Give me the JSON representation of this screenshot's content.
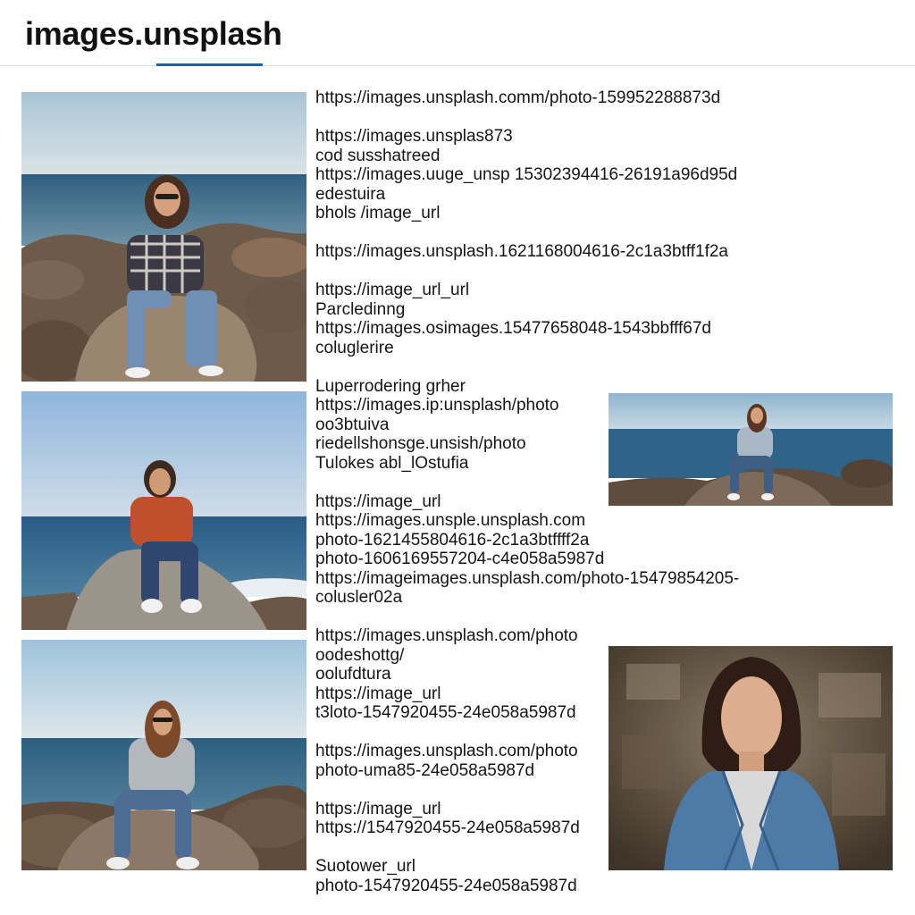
{
  "header": {
    "title": "images.unsplash"
  },
  "images": [
    {
      "name": "photo-woman-plaid-shirt-on-rocks"
    },
    {
      "name": "photo-man-orange-sweater-on-rock"
    },
    {
      "name": "photo-woman-gray-sweater-on-rocks"
    },
    {
      "name": "photo-woman-seated-rocks-wide"
    },
    {
      "name": "photo-woman-denim-jacket-portrait"
    }
  ],
  "text_lines": [
    "https://images.unsplash.comm/photo-159952288873d",
    "",
    "https://images.unsplas873",
    "cod susshatreed",
    "https://images.uuge_unsp 15302394416-26191a96d95d",
    "edestuira",
    "bhols /image_url",
    "",
    "https://images.unsplash.1621168004616-2c1a3btff1f2a",
    "",
    "https://image_url_url",
    "Parcledinng",
    "https://images.osimages.15477658048-1543bbfff67d",
    "coluglerire",
    "",
    "Luperrodering grher",
    "https://images.ip:unsplash/photo",
    "oo3btuiva",
    "riedellshonsge.unsish/photo",
    "Tulokes abl_lOstufia",
    "",
    "https://image_url",
    "https://images.unsple.unsplash.com",
    "photo-16214558046​16-2c1a3btffff2a",
    "photo-1606169557204-c4e058a5987d",
    "https://imageimages.unsplash.com/photo-15479854205-",
    "colusler02a",
    "",
    "https://images.unsplash.com/photo",
    "oodeshottg/",
    "oolufdtura",
    "https://image_url",
    "t3loto-1547920455-24e058a5987d",
    "",
    "https://images.unsplash.com/photo",
    "photo-uma85-24e058a5987d",
    "",
    "https://image_url",
    "https://1547920455-24e058a5987d",
    "",
    "Suotower_url",
    "photo-1547920455-24e058a5987d"
  ]
}
